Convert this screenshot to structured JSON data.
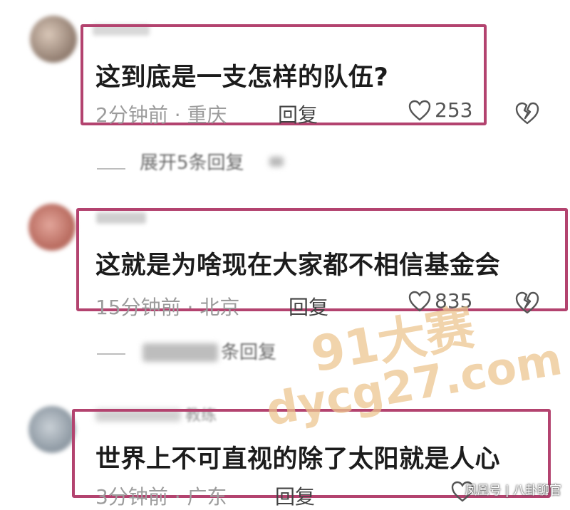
{
  "comments": [
    {
      "text": "这到底是一支怎样的队伍?",
      "time": "2分钟前",
      "location": "重庆",
      "reply_label": "回复",
      "likes": "253",
      "expand": "展开5条回复"
    },
    {
      "text": "这就是为啥现在大家都不相信基金会",
      "time": "15分钟前",
      "location": "北京",
      "reply_label": "回复",
      "likes": "835",
      "expand": "条回复"
    },
    {
      "username": "教练",
      "text": "世界上不可直视的除了太阳就是人心",
      "time": "3分钟前",
      "location": "广东",
      "reply_label": "回复"
    }
  ],
  "watermark": {
    "line1": "91大赛",
    "line2": "dycg27.com"
  },
  "footer": {
    "brand": "凤凰号 | 八卦聊官"
  },
  "colors": {
    "highlight": "#b3436f",
    "watermark": "#ecc48c"
  }
}
